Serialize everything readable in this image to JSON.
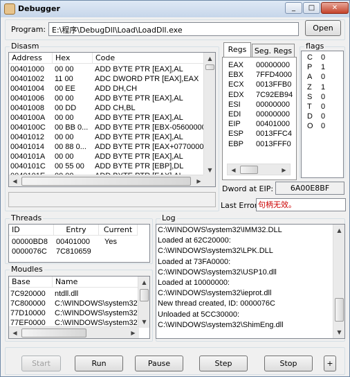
{
  "window": {
    "title": "Debugger",
    "min": "_",
    "max": "□",
    "close": "✕"
  },
  "program": {
    "label": "Program:",
    "path": "E:\\程序\\DebugDll\\Load\\LoadDll.exe",
    "open_label": "Open"
  },
  "disasm": {
    "title": "Disasm",
    "columns": [
      "Address",
      "Hex",
      "Code"
    ],
    "rows": [
      [
        "00401000",
        "00 00",
        "ADD BYTE PTR [EAX],AL"
      ],
      [
        "00401002",
        "11 00",
        "ADC DWORD PTR [EAX],EAX"
      ],
      [
        "00401004",
        "00 EE",
        "ADD DH,CH"
      ],
      [
        "00401006",
        "00 00",
        "ADD BYTE PTR [EAX],AL"
      ],
      [
        "00401008",
        "00 DD",
        "ADD CH,BL"
      ],
      [
        "0040100A",
        "00 00",
        "ADD BYTE PTR [EAX],AL"
      ],
      [
        "0040100C",
        "00 BB 0...",
        "ADD BYTE PTR [EBX-05600000"
      ],
      [
        "00401012",
        "00 00",
        "ADD BYTE PTR [EAX],AL"
      ],
      [
        "00401014",
        "00 88 0...",
        "ADD BYTE PTR [EAX+07700000"
      ],
      [
        "0040101A",
        "00 00",
        "ADD BYTE PTR [EAX],AL"
      ],
      [
        "0040101C",
        "00 55 00",
        "ADD BYTE PTR [EBP],DL"
      ],
      [
        "0040101E",
        "00 00",
        "ADD BYTE PTR [EAX],AL"
      ]
    ]
  },
  "regs": {
    "tabs": [
      "Regs",
      "Seg. Regs"
    ],
    "rows": [
      [
        "EAX",
        "00000000"
      ],
      [
        "EBX",
        "7FFD4000"
      ],
      [
        "ECX",
        "0013FFB0"
      ],
      [
        "EDX",
        "7C92EB94"
      ],
      [
        "ESI",
        "00000000"
      ],
      [
        "EDI",
        "00000000"
      ],
      [
        "EIP",
        "00401000"
      ],
      [
        "ESP",
        "0013FFC4"
      ],
      [
        "EBP",
        "0013FFF0"
      ]
    ]
  },
  "flags": {
    "title": "flags",
    "rows": [
      [
        "C",
        "0"
      ],
      [
        "P",
        "1"
      ],
      [
        "A",
        "0"
      ],
      [
        "Z",
        "1"
      ],
      [
        "S",
        "0"
      ],
      [
        "T",
        "0"
      ],
      [
        "D",
        "0"
      ],
      [
        "O",
        "0"
      ]
    ]
  },
  "dword": {
    "label": "Dword at EIP:",
    "value": "6A00E8BF"
  },
  "last_error": {
    "label": "Last Error:",
    "value": "句柄无效。",
    "color": "#cc0000"
  },
  "threads": {
    "title": "Threads",
    "columns": [
      "ID",
      "Entry",
      "Current"
    ],
    "rows": [
      [
        "00000BD8",
        "00401000",
        "Yes"
      ],
      [
        "0000076C",
        "7C810659",
        ""
      ]
    ]
  },
  "modules": {
    "title": "Moudles",
    "columns": [
      "Base",
      "Name"
    ],
    "rows": [
      [
        "7C920000",
        "ntdll.dll"
      ],
      [
        "7C800000",
        "C:\\WINDOWS\\system32\\"
      ],
      [
        "77D10000",
        "C:\\WINDOWS\\system32\\"
      ],
      [
        "77EF0000",
        "C:\\WINDOWS\\system32\\"
      ]
    ]
  },
  "log": {
    "title": "Log",
    "lines": [
      "C:\\WINDOWS\\system32\\IMM32.DLL",
      "Loaded at 62C20000:",
      "C:\\WINDOWS\\system32\\LPK.DLL",
      "Loaded at 73FA0000:",
      "C:\\WINDOWS\\system32\\USP10.dll",
      "Loaded at 10000000:",
      "C:\\WINDOWS\\system32\\ieprot.dll",
      "New thread created, ID: 0000076C",
      "Unloaded at 5CC30000:",
      "C:\\WINDOWS\\system32\\ShimEng.dll"
    ]
  },
  "controls": {
    "start": "Start",
    "run": "Run",
    "pause": "Pause",
    "step": "Step",
    "stop": "Stop",
    "plus": "+"
  }
}
